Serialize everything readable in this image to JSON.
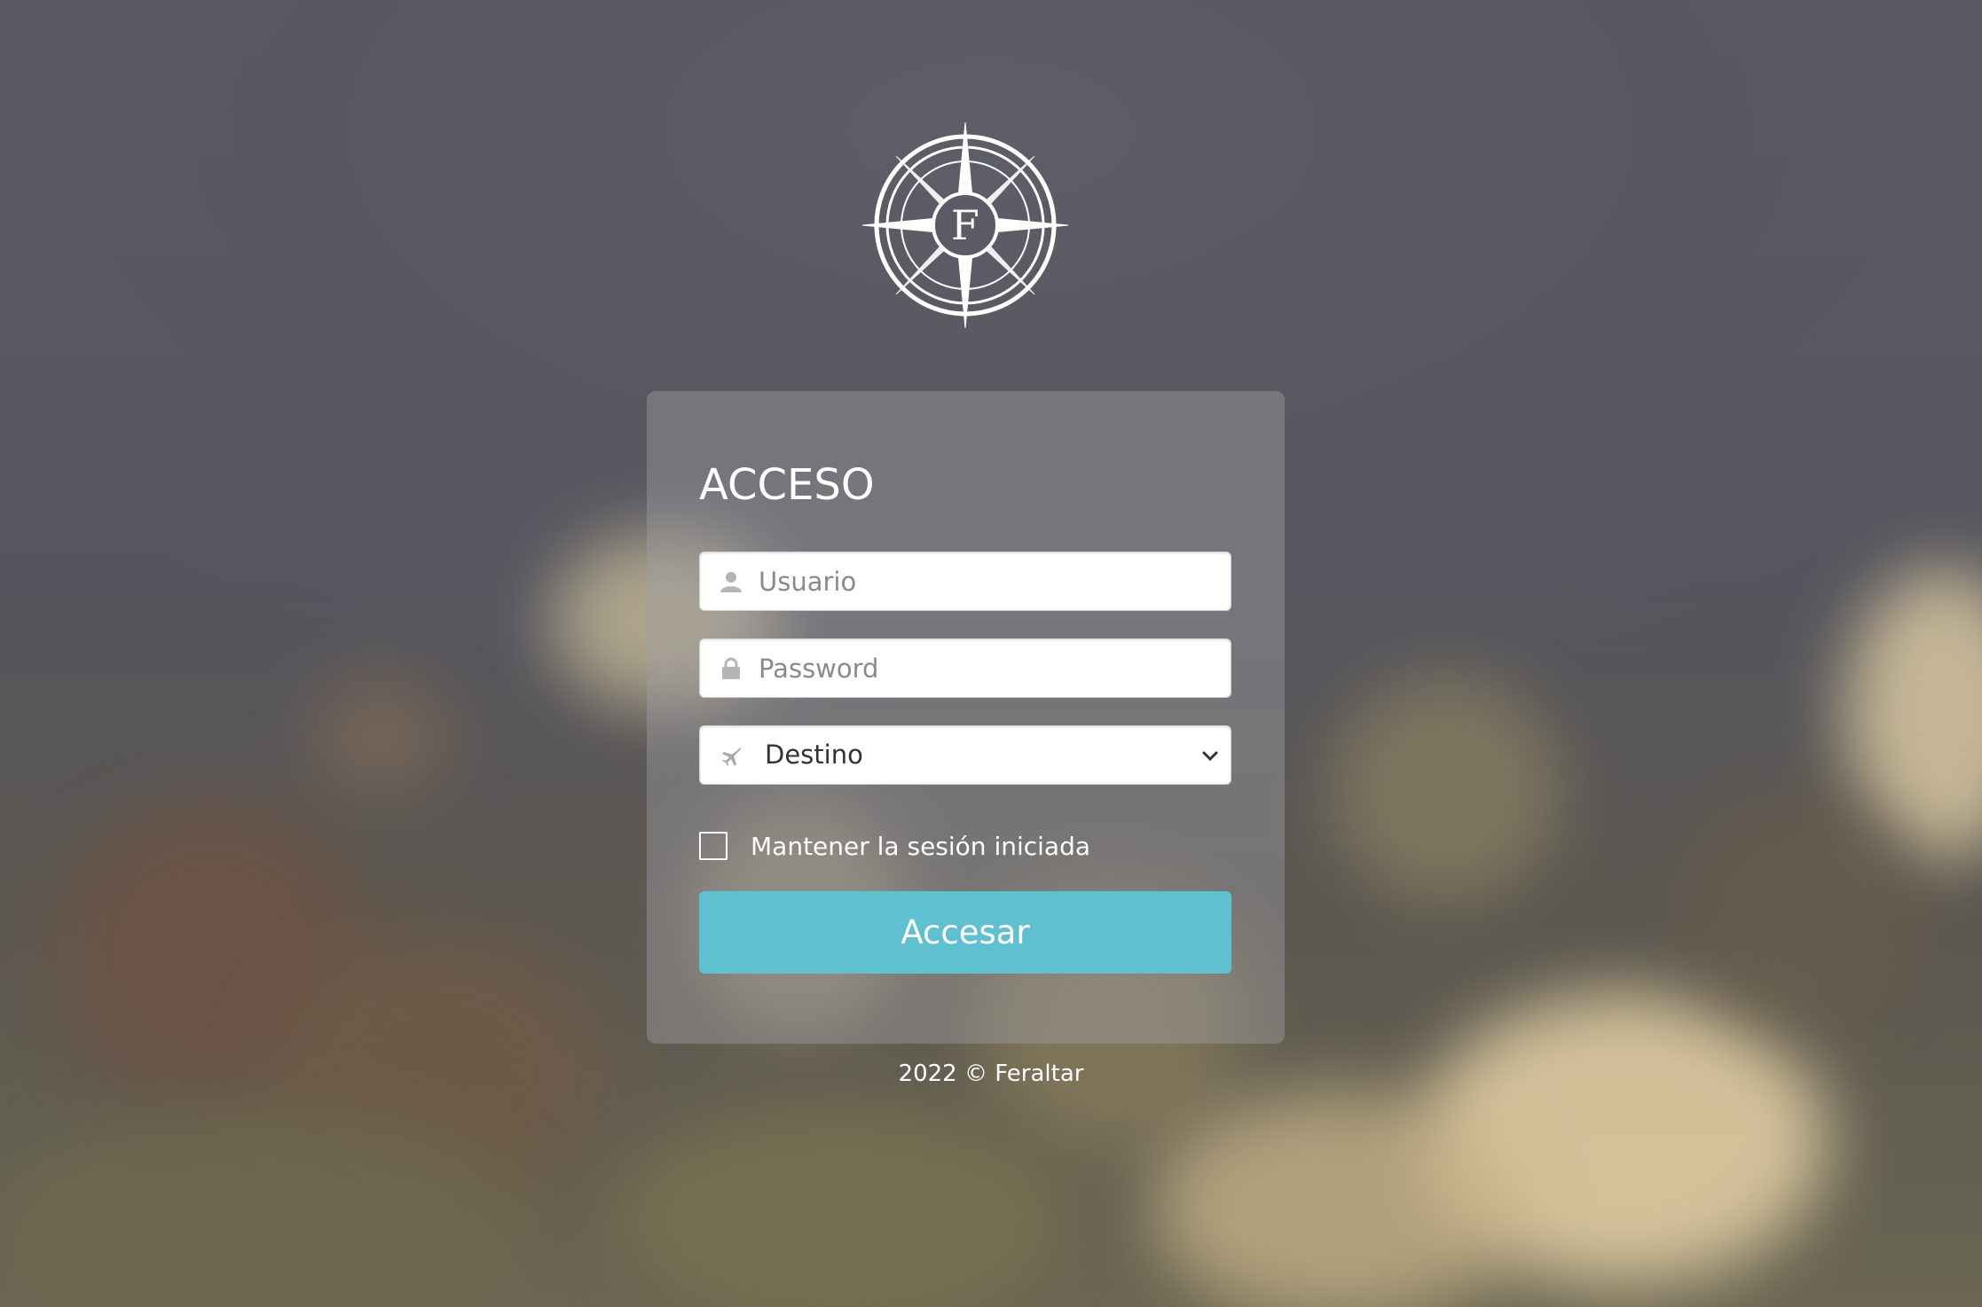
{
  "brand": {
    "logo_letter": "F",
    "logo_icon": "compass-rose-logo"
  },
  "login": {
    "title": "ACCESO",
    "username": {
      "placeholder": "Usuario",
      "value": "",
      "icon": "user-icon"
    },
    "password": {
      "placeholder": "Password",
      "value": "",
      "icon": "lock-icon"
    },
    "destination": {
      "selected": "Destino",
      "icon": "plane-icon"
    },
    "remember": {
      "label": "Mantener la sesión iniciada",
      "checked": false
    },
    "submit_label": "Accesar"
  },
  "footer": {
    "text": "2022 © Feraltar"
  },
  "colors": {
    "accent": "#5fc1cf",
    "card": "rgba(160,160,165,0.42)",
    "text": "#ffffff"
  }
}
